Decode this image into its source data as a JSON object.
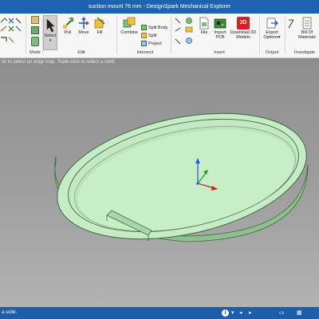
{
  "window": {
    "title": "suction mount 76 mm - DesignSpark Mechanical Explorer"
  },
  "ribbon": {
    "mode": {
      "label": "Mode"
    },
    "edit": {
      "label": "Edit",
      "select": "Select",
      "pull": "Pull",
      "move": "Move",
      "fill": "Fill"
    },
    "intersect": {
      "label": "Intersect",
      "combine": "Combine",
      "split_body": "Split Body",
      "split": "Split",
      "project": "Project"
    },
    "insert": {
      "label": "Insert",
      "file": "File",
      "import_pcb_1": "Import",
      "import_pcb_2": "PCB",
      "download_3d_1": "Download 3D",
      "download_3d_2": "Models",
      "badge_3d": "3D"
    },
    "output": {
      "label": "Output",
      "export_1": "Export",
      "export_2": "Options"
    },
    "investigate": {
      "label": "Investigate",
      "bom_1": "Bill Of",
      "bom_2": "Materials"
    }
  },
  "hint": {
    "text": "ck to select an edge loop. Triple-click to select a solid."
  },
  "statusbar": {
    "text": "a solid."
  },
  "colors": {
    "titlebar": "#1e63b0",
    "statusbar": "#1e5ea8",
    "part_fill": "#c6ecc6",
    "part_edge": "#3c6a3c",
    "axis_x": "#d62020",
    "axis_y": "#20a020",
    "axis_z": "#2060e0"
  }
}
